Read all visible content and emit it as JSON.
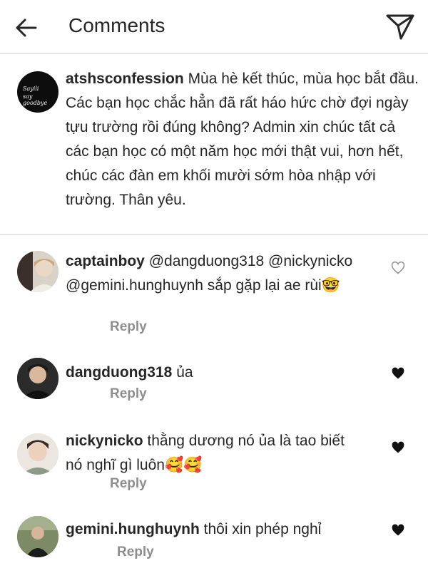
{
  "header": {
    "title": "Comments",
    "back_icon": "arrow-left-icon",
    "send_icon": "paper-plane-icon"
  },
  "caption": {
    "username": "atshsconfession",
    "text": "Mùa hè kết thúc, mùa học bắt đầu. Các bạn học chắc hẳn đã rất háo hức chờ đợi ngày tựu trường rồi đúng không? Admin xin chúc tất cả các bạn học có một năm học mới thật vui, hơn hết, chúc các đàn em khối mười sớm hòa nhập với trường. Thân yêu.",
    "avatar_logo_top": "Sayili",
    "avatar_logo_bottom": "say goodbye"
  },
  "comments": [
    {
      "username": "captainboy",
      "text": "@dangduong318 @nickynicko @gemini.hunghuynh sắp gặp lại ae rùi🤓",
      "reply_label": "Reply",
      "liked": false
    },
    {
      "username": "dangduong318",
      "text": "ủa",
      "reply_label": "Reply",
      "liked": true
    },
    {
      "username": "nickynicko",
      "text": "thằng dương nó ủa là tao biết nó nghĩ gì luôn🥰🥰",
      "reply_label": "Reply",
      "liked": true
    },
    {
      "username": "gemini.hunghuynh",
      "text": "thôi xin phép nghỉ",
      "reply_label": "Reply",
      "liked": true
    }
  ],
  "colors": {
    "text": "#262626",
    "muted": "#8e8e8e",
    "divider": "#e6e6e6",
    "like_filled": "#111111",
    "like_empty": "#8e8e8e"
  }
}
